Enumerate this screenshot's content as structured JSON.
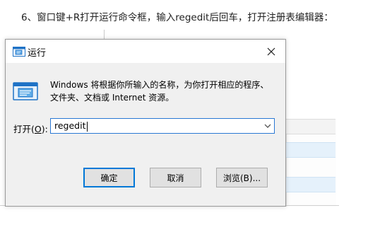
{
  "instruction": "6、窗口键+R打开运行命令框，输入regedit后回车，打开注册表编辑器：",
  "dialog": {
    "title": "运行",
    "description_line1": "Windows 将根据你所输入的名称，为你打开相应的程序、",
    "description_line2": "文件夹、文档或 Internet 资源。",
    "open_label_prefix": "打开(",
    "open_label_key": "O",
    "open_label_suffix": "):",
    "open_value": "regedit",
    "ok_label": "确定",
    "cancel_label": "取消",
    "browse_label": "浏览(B)...",
    "close_icon": "close-icon",
    "app_icon": "run-icon"
  },
  "colors": {
    "accent": "#0078d7",
    "dialog_bg": "#f0f0f0",
    "button_bg": "#e1e1e1"
  }
}
